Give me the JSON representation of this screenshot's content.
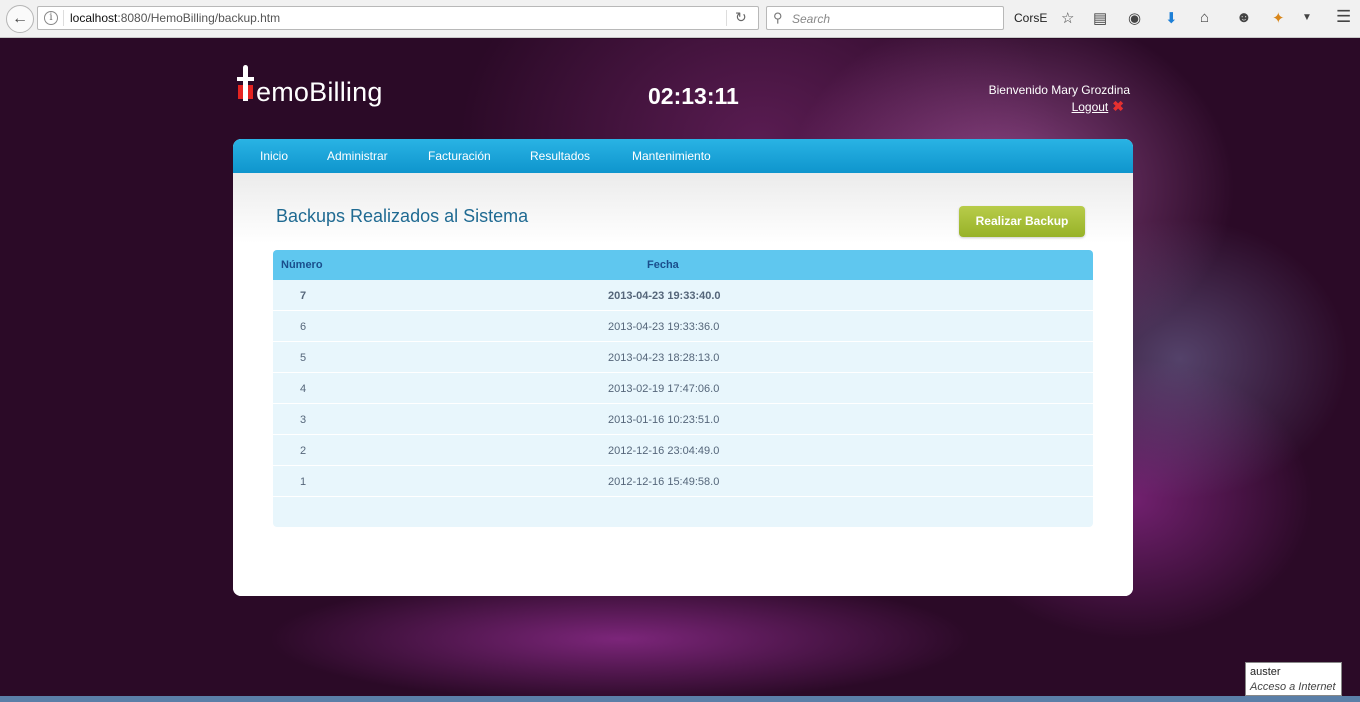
{
  "browser": {
    "url_host": "localhost",
    "url_rest": ":8080/HemoBilling/backup.htm",
    "search_placeholder": "Search",
    "profile_label": "CorsE"
  },
  "header": {
    "logo_text": "emoBilling",
    "clock": "02:13:11",
    "welcome": "Bienvenido Mary Grozdina",
    "logout_label": "Logout"
  },
  "nav": {
    "items": [
      "Inicio",
      "Administrar",
      "Facturación",
      "Resultados",
      "Mantenimiento"
    ]
  },
  "main": {
    "title": "Backups Realizados al Sistema",
    "backup_button": "Realizar Backup",
    "table": {
      "columns": [
        "Número",
        "Fecha"
      ],
      "rows": [
        {
          "numero": "7",
          "fecha": "2013-04-23 19:33:40.0"
        },
        {
          "numero": "6",
          "fecha": "2013-04-23 19:33:36.0"
        },
        {
          "numero": "5",
          "fecha": "2013-04-23 18:28:13.0"
        },
        {
          "numero": "4",
          "fecha": "2013-02-19 17:47:06.0"
        },
        {
          "numero": "3",
          "fecha": "2013-01-16 10:23:51.0"
        },
        {
          "numero": "2",
          "fecha": "2012-12-16 23:04:49.0"
        },
        {
          "numero": "1",
          "fecha": "2012-12-16 15:49:58.0"
        }
      ]
    }
  },
  "tooltip": {
    "line1": "auster",
    "line2": "Acceso a Internet"
  },
  "colors": {
    "nav_blue": "#1fa6da",
    "table_header": "#5fc7ef",
    "button_green": "#a6bf36",
    "title_blue": "#1f6a92",
    "logo_red": "#e52421"
  }
}
